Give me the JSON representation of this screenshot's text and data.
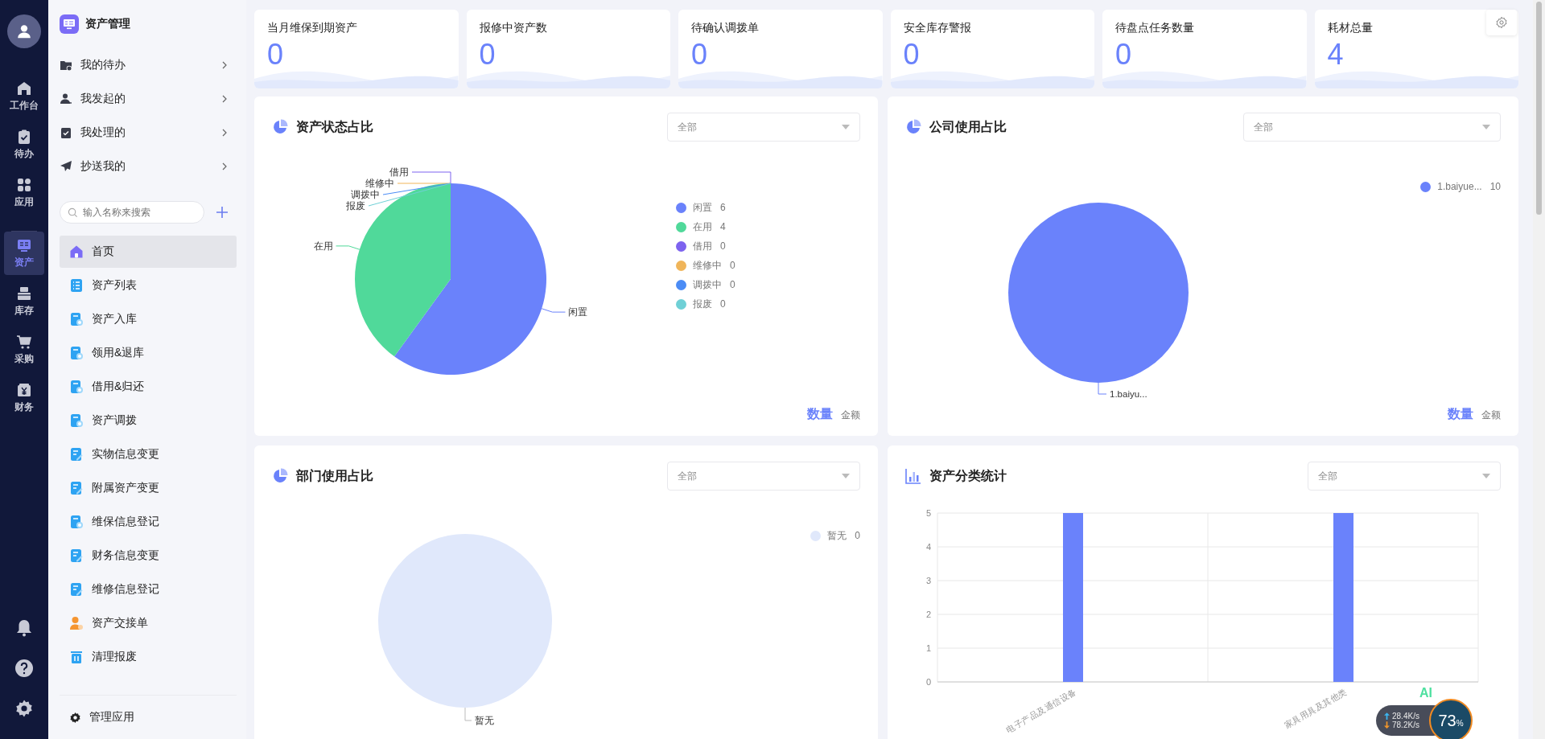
{
  "rail": {
    "items": [
      {
        "label": "工作台",
        "kind": "home",
        "selected": false
      },
      {
        "label": "待办",
        "kind": "clipboard",
        "selected": false
      },
      {
        "label": "应用",
        "kind": "apps",
        "selected": false
      },
      {
        "label": "资产",
        "kind": "asset",
        "selected": true
      },
      {
        "label": "库存",
        "kind": "stock",
        "selected": false
      },
      {
        "label": "采购",
        "kind": "cart",
        "selected": false
      },
      {
        "label": "财务",
        "kind": "yen",
        "selected": false
      }
    ]
  },
  "sidebar": {
    "title": "资产管理",
    "quick": [
      {
        "label": "我的待办",
        "kind": "folder"
      },
      {
        "label": "我发起的",
        "kind": "person"
      },
      {
        "label": "我处理的",
        "kind": "clipboard"
      },
      {
        "label": "抄送我的",
        "kind": "plane"
      }
    ],
    "search": {
      "placeholder": "输入名称来搜索"
    },
    "items": [
      {
        "label": "首页",
        "kind": "home",
        "selected": true
      },
      {
        "label": "资产列表",
        "kind": "list",
        "selected": false
      },
      {
        "label": "资产入库",
        "kind": "doc",
        "selected": false
      },
      {
        "label": "领用&退库",
        "kind": "doc",
        "selected": false
      },
      {
        "label": "借用&归还",
        "kind": "doc",
        "selected": false
      },
      {
        "label": "资产调拨",
        "kind": "doc",
        "selected": false
      },
      {
        "label": "实物信息变更",
        "kind": "edit",
        "selected": false
      },
      {
        "label": "附属资产变更",
        "kind": "edit",
        "selected": false
      },
      {
        "label": "维保信息登记",
        "kind": "doc",
        "selected": false
      },
      {
        "label": "财务信息变更",
        "kind": "edit",
        "selected": false
      },
      {
        "label": "维修信息登记",
        "kind": "edit",
        "selected": false
      },
      {
        "label": "资产交接单",
        "kind": "person",
        "selected": false
      },
      {
        "label": "清理报废",
        "kind": "trash",
        "selected": false
      }
    ],
    "footer": "管理应用"
  },
  "stats": [
    {
      "label": "当月维保到期资产",
      "value": "0"
    },
    {
      "label": "报修中资产数",
      "value": "0"
    },
    {
      "label": "待确认调拨单",
      "value": "0"
    },
    {
      "label": "安全库存警报",
      "value": "0"
    },
    {
      "label": "待盘点任务数量",
      "value": "0"
    },
    {
      "label": "耗材总量",
      "value": "4"
    }
  ],
  "panels": [
    {
      "title": "资产状态占比",
      "kind": "pie",
      "filter": "全部",
      "chart_data": {
        "type": "pie",
        "categories": [
          "闲置",
          "在用",
          "借用",
          "维修中",
          "调拨中",
          "报废"
        ],
        "series": [
          {
            "values": [
              60,
              40,
              0,
              0,
              0,
              0
            ]
          }
        ]
      },
      "legend": [
        {
          "label": "闲置",
          "value": "6",
          "color": "#6a82fb"
        },
        {
          "label": "在用",
          "value": "4",
          "color": "#50d99a"
        },
        {
          "label": "借用",
          "value": "0",
          "color": "#7d63ef"
        },
        {
          "label": "维修中",
          "value": "0",
          "color": "#f0b55a"
        },
        {
          "label": "调拨中",
          "value": "0",
          "color": "#4b8cf5"
        },
        {
          "label": "报废",
          "value": "0",
          "color": "#6fd0d6"
        }
      ],
      "metric_toggle": [
        {
          "label": "数量",
          "selected": true
        },
        {
          "label": "金额",
          "selected": false
        }
      ]
    },
    {
      "title": "公司使用占比",
      "kind": "pie",
      "filter": "全部",
      "chart_data": {
        "type": "pie",
        "categories": [
          "1.baiyu..."
        ],
        "series": [
          {
            "values": [
              100
            ]
          }
        ]
      },
      "legend": [
        {
          "label": "1.baiyue...",
          "value": "10",
          "color": "#6a82fb"
        }
      ],
      "metric_toggle": [
        {
          "label": "数量",
          "selected": true
        },
        {
          "label": "金额",
          "selected": false
        }
      ]
    },
    {
      "title": "部门使用占比",
      "kind": "empty",
      "filter": "全部",
      "empty_label": "暂无",
      "legend": [
        {
          "label": "暂无",
          "value": "0",
          "color": "#e0e8fb"
        }
      ]
    },
    {
      "title": "资产分类统计",
      "kind": "bar",
      "filter": "全部",
      "chart_data": {
        "type": "bar",
        "categories": [
          "电子产品及通信设备",
          "家具用具及其他类"
        ],
        "series": [
          {
            "color": "#6a82fb",
            "values": [
              5,
              5
            ]
          }
        ],
        "ylim": [
          0,
          5
        ],
        "yticks": [
          0,
          1,
          2,
          3,
          4,
          5
        ],
        "grid": true
      }
    }
  ],
  "net_widget": {
    "badge": "AI",
    "upload": "28.4K/s",
    "download": "78.2K/s",
    "percent": "73",
    "unit": "%"
  }
}
